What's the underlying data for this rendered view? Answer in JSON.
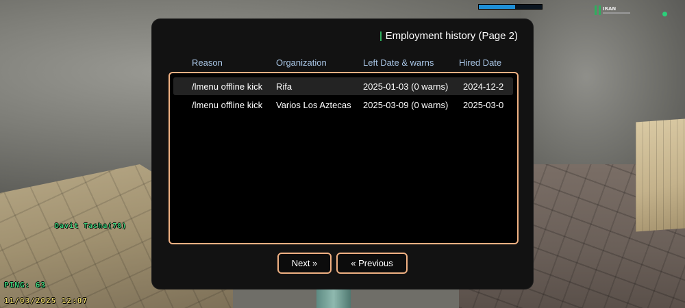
{
  "hud": {
    "player_tag": "Davit Tasha(78)",
    "ping": "PING: 63",
    "datetime": "11/03/2025 12:07",
    "health_bar_percent": 58,
    "logo_text": "IRAN",
    "status_color": "#2ad17a"
  },
  "dialog": {
    "title": "Employment history (Page 2)",
    "columns": [
      "Reason",
      "Organization",
      "Left Date & warns",
      "Hired Date"
    ],
    "rows": [
      {
        "reason": "/lmenu offline kick",
        "organization": "Rifa",
        "left_date_warns": "2025-01-03 (0 warns)",
        "hired_date": "2024-12-2"
      },
      {
        "reason": "/lmenu offline kick",
        "organization": "Varios Los Aztecas",
        "left_date_warns": "2025-03-09 (0 warns)",
        "hired_date": "2025-03-0"
      }
    ],
    "next_label": "Next »",
    "previous_label": "« Previous"
  },
  "colors": {
    "accent_border": "#f0b183",
    "header_text": "#a9c6e6",
    "title_accent": "#2fae5e",
    "dialog_bg": "#121212"
  }
}
